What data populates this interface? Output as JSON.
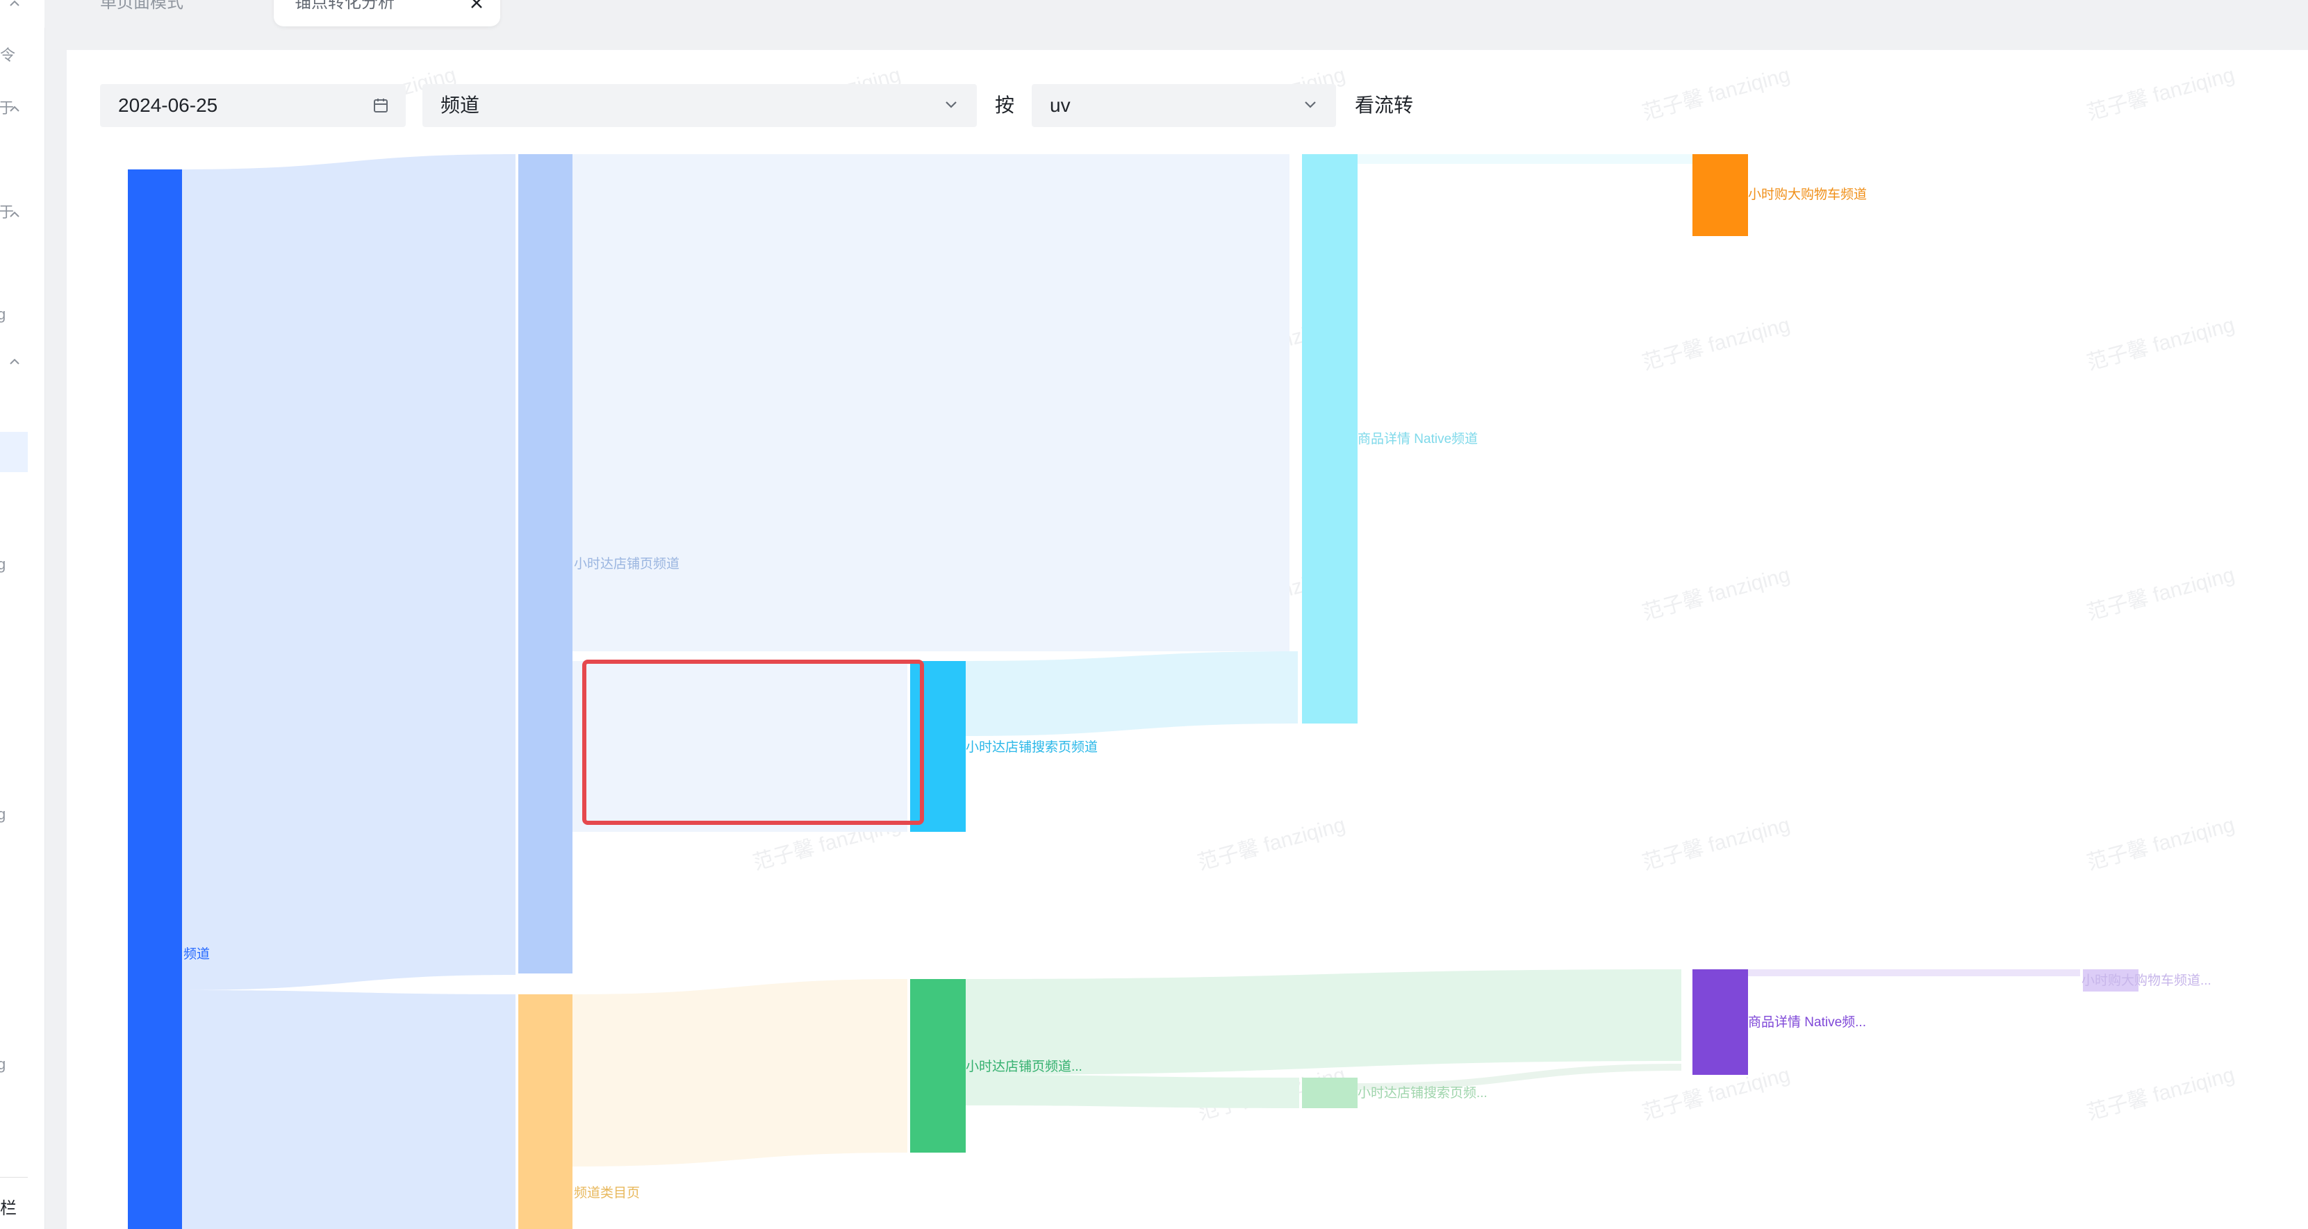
{
  "sidebar": {
    "bottom_label": "栏",
    "fragments": [
      "令",
      "于",
      "于",
      "g",
      "g",
      "g",
      "g"
    ]
  },
  "tabs": {
    "inactive_label": "单页面模式",
    "active_label": "锚点转化分析"
  },
  "filters": {
    "date_value": "2024-06-25",
    "dimension_value": "频道",
    "by_label": "按",
    "metric_value": "uv",
    "view_label": "看流转"
  },
  "watermark_text": "范子馨 fanziqing",
  "sankey": {
    "nodes": [
      {
        "id": "n0",
        "label": "频道",
        "color": "#2468ff"
      },
      {
        "id": "n1",
        "label": "小时达店铺页频道",
        "color": "#b3cdfa"
      },
      {
        "id": "n2",
        "label": "频道类目页",
        "color": "#ffd088"
      },
      {
        "id": "n3",
        "label": "小时达店铺搜索页频道",
        "color": "#29c6fb"
      },
      {
        "id": "n4",
        "label": "小时达店铺页频道...",
        "color": "#40c77d"
      },
      {
        "id": "n5",
        "label": "商品详情 Native频道",
        "color": "#9aeefc"
      },
      {
        "id": "n6",
        "label": "小时达店铺搜索页频...",
        "color": "#bbeac8"
      },
      {
        "id": "n7",
        "label": "小时购大购物车频道",
        "color": "#ff8f0f"
      },
      {
        "id": "n8",
        "label": "商品详情 Native频...",
        "color": "#7f48d8"
      },
      {
        "id": "n9",
        "label": "小时购大购物车频道...",
        "color": "#dccdf7"
      }
    ],
    "label_colors": {
      "n0": "#2468ff",
      "n1": "#9ab5e0",
      "n2": "#e8b85c",
      "n3": "#29b7e8",
      "n4": "#33b06e",
      "n5": "#7fd9ea",
      "n6": "#9fd5ac",
      "n7": "#f0901a",
      "n8": "#7f48d8",
      "n9": "#c7b6ea"
    }
  }
}
